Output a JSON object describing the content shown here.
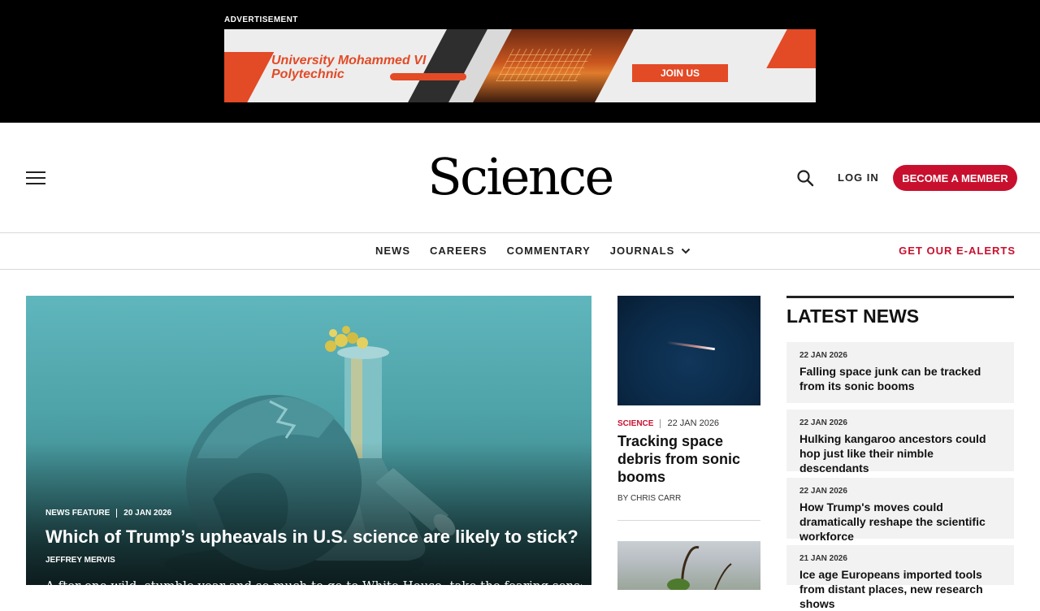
{
  "ad": {
    "label": "ADVERTISEMENT",
    "title_line1": "University Mohammed VI",
    "title_line2": "Polytechnic",
    "cta": "JOIN US"
  },
  "header": {
    "logo": "Science",
    "login": "LOG IN",
    "member_button": "BECOME A MEMBER",
    "accent_color": "#c8102e"
  },
  "nav": {
    "items": [
      "NEWS",
      "CAREERS",
      "COMMENTARY",
      "JOURNALS"
    ],
    "alerts": "GET OUR E-ALERTS"
  },
  "hero": {
    "section": "NEWS FEATURE",
    "date": "20 JAN 2026",
    "title": "Which of Trump’s upheavals in U.S. science are likely to stick?",
    "author": "JEFFREY MERVIS",
    "teaser": "A fter one wild, stumble year and so much to go to White House, take the fearing sense in"
  },
  "middle": {
    "section": "SCIENCE",
    "date": "22 JAN 2026",
    "title": "Tracking space debris from sonic booms",
    "author": "BY CHRIS CARR"
  },
  "latest": {
    "heading": "LATEST NEWS",
    "items": [
      {
        "date": "22 JAN 2026",
        "title": "Falling space junk can be tracked from its sonic booms"
      },
      {
        "date": "22 JAN 2026",
        "title": "Hulking kangaroo ancestors could hop just like their nimble descendants"
      },
      {
        "date": "22 JAN 2026",
        "title": "How Trump's moves could dramatically reshape the scientific workforce"
      },
      {
        "date": "21 JAN 2026",
        "title": "Ice age Europeans imported tools from distant places, new research shows"
      }
    ]
  }
}
